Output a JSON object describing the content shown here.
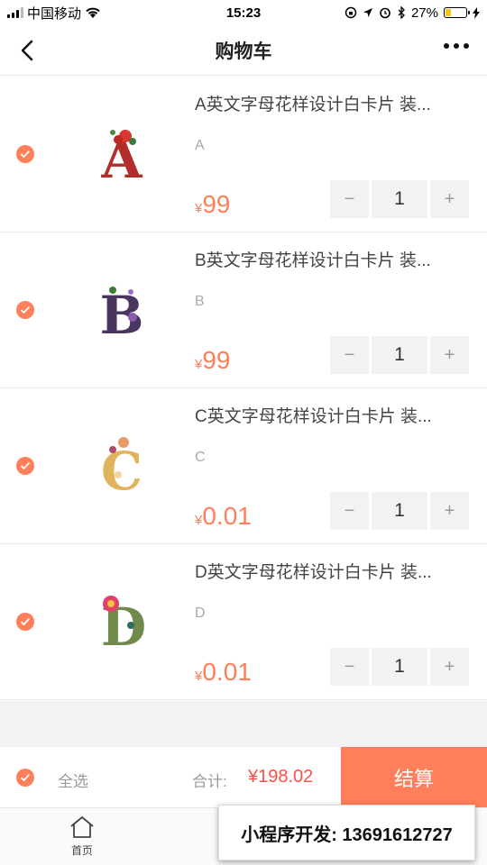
{
  "status_bar": {
    "carrier": "中国移动",
    "time": "15:23",
    "battery": "27%",
    "battery_level": 0.27
  },
  "nav": {
    "title": "购物车"
  },
  "items": [
    {
      "title": "A英文字母花样设计白卡片 装...",
      "spec": "A",
      "currency": "¥",
      "price": "99",
      "qty": "1",
      "letter": "A",
      "minus": "−",
      "plus": "+"
    },
    {
      "title": "B英文字母花样设计白卡片 装...",
      "spec": "B",
      "currency": "¥",
      "price": "99",
      "qty": "1",
      "letter": "B",
      "minus": "−",
      "plus": "+"
    },
    {
      "title": "C英文字母花样设计白卡片 装...",
      "spec": "C",
      "currency": "¥",
      "price": "0.01",
      "qty": "1",
      "letter": "C",
      "minus": "−",
      "plus": "+"
    },
    {
      "title": "D英文字母花样设计白卡片 装...",
      "spec": "D",
      "currency": "¥",
      "price": "0.01",
      "qty": "1",
      "letter": "D",
      "minus": "−",
      "plus": "+"
    }
  ],
  "checkout": {
    "select_all": "全选",
    "total_label": "合计:",
    "total_value": "¥198.02",
    "pay_label": "结算"
  },
  "tabbar": {
    "home_label": "首页"
  },
  "promo": {
    "text": "小程序开发: 13691612727"
  },
  "colors": {
    "accent": "#ff7f5a",
    "total": "#ff4f45"
  }
}
